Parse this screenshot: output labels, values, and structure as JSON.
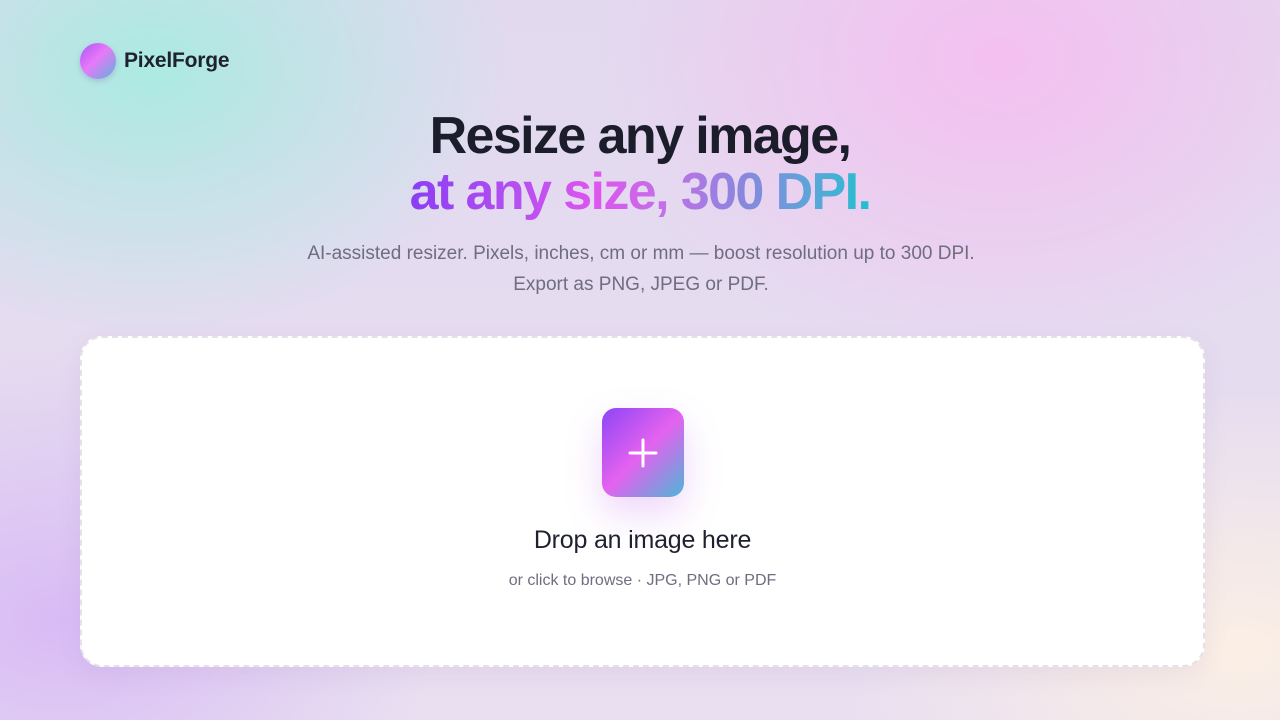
{
  "brand": {
    "name": "PixelForge",
    "logo_icon": "gradient-circle-logo"
  },
  "hero": {
    "title_line1": "Resize any image,",
    "title_line2": "at any size, 300 DPI.",
    "subtitle": "AI-assisted resizer. Pixels, inches, cm or mm — boost resolution up to 300 DPI. Export as PNG, JPEG or PDF."
  },
  "dropzone": {
    "icon": "plus-icon",
    "title": "Drop an image here",
    "hint": "or click to browse · JPG, PNG or PDF"
  },
  "colors": {
    "text_dark": "#1f2130",
    "text_muted": "#6f6d80",
    "gradient_start": "#8b3df5",
    "gradient_mid": "#dd55ef",
    "gradient_end": "#1fc0d0"
  }
}
